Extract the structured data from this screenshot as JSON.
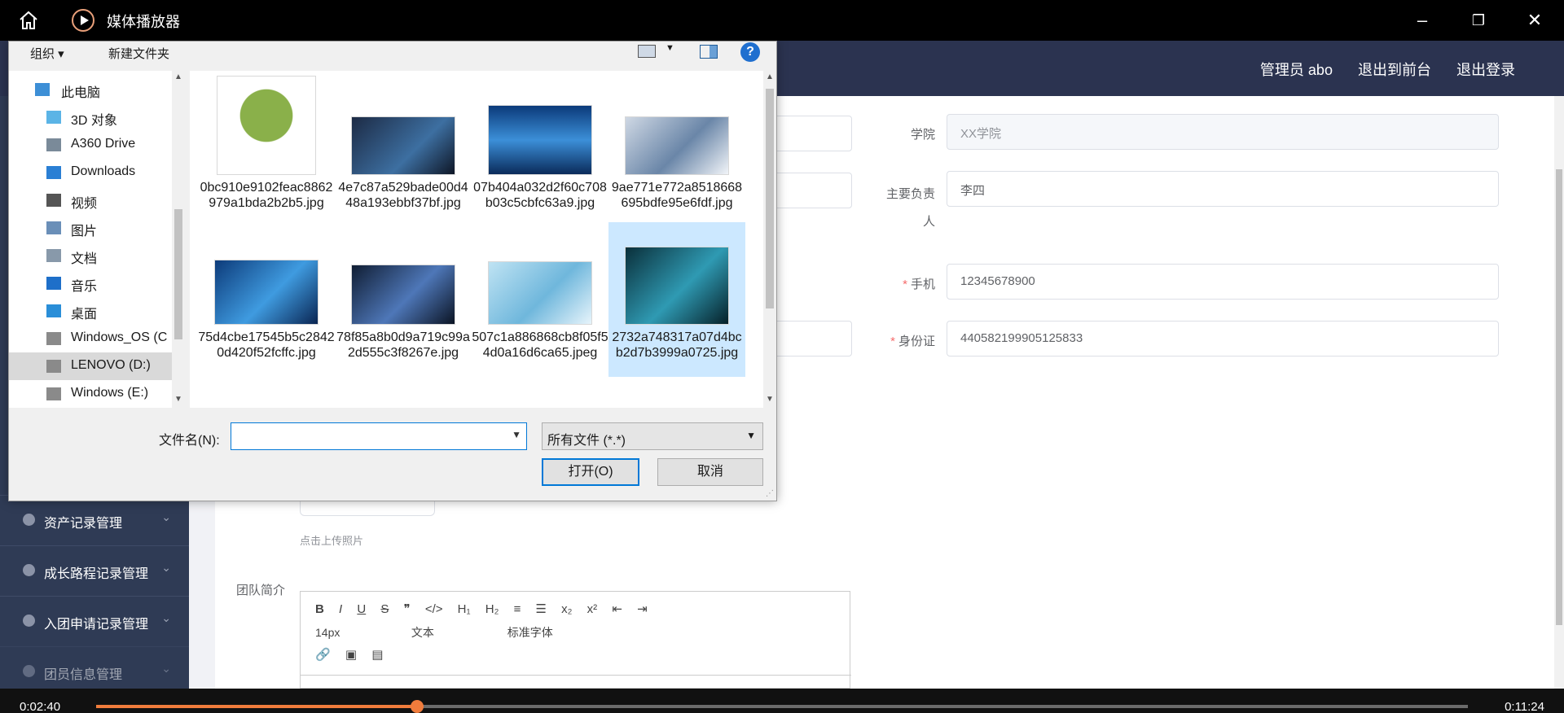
{
  "player": {
    "title": "媒体播放器",
    "current_time": "0:02:40",
    "total_time": "0:11:24",
    "progress": 0.234
  },
  "app": {
    "header_links": [
      "管理员 abo",
      "退出到前台",
      "退出登录"
    ],
    "sidebar": [
      {
        "label": "资产记录管理"
      },
      {
        "label": "成长路程记录管理"
      },
      {
        "label": "入团申请记录管理"
      },
      {
        "label": "团员信息管理"
      }
    ],
    "form": {
      "college_label": "学院",
      "college_value": "XX学院",
      "leader_label": "主要负责人",
      "leader_value": "李四",
      "phone_label": "手机",
      "phone_value": "12345678900",
      "id_label": "身份证",
      "id_value": "440582199905125833",
      "upload_hint": "点击上传照片",
      "team_intro_label": "团队简介"
    },
    "editor": {
      "row1": [
        "B",
        "I",
        "U",
        "S",
        "❞",
        "</>",
        "H₁",
        "H₂",
        "≡",
        "☰",
        "x₂",
        "x²",
        "⇤",
        "⇥"
      ],
      "font_size": "14px",
      "text_style": "文本",
      "font_family": "标准字体"
    }
  },
  "dialog": {
    "organize": "组织 ▾",
    "new_folder": "新建文件夹",
    "nav": [
      {
        "label": "此电脑",
        "icon": "computer-icon"
      },
      {
        "label": "3D 对象",
        "icon": "3d-objects-icon"
      },
      {
        "label": "A360 Drive",
        "icon": "cloud-drive-icon"
      },
      {
        "label": "Downloads",
        "icon": "download-icon"
      },
      {
        "label": "视频",
        "icon": "video-icon"
      },
      {
        "label": "图片",
        "icon": "pictures-icon"
      },
      {
        "label": "文档",
        "icon": "documents-icon"
      },
      {
        "label": "音乐",
        "icon": "music-icon"
      },
      {
        "label": "桌面",
        "icon": "desktop-icon"
      },
      {
        "label": "Windows_OS (C",
        "icon": "drive-icon"
      },
      {
        "label": "LENOVO (D:)",
        "icon": "drive-icon"
      },
      {
        "label": "Windows (E:)",
        "icon": "drive-icon"
      }
    ],
    "files": [
      {
        "name": "0bc910e9102feac8862979a1bda2b2b5.jpg"
      },
      {
        "name": "4e7c87a529bade00d448a193ebbf37bf.jpg"
      },
      {
        "name": "07b404a032d2f60c708b03c5cbfc63a9.jpg"
      },
      {
        "name": "9ae771e772a8518668695bdfe95e6fdf.jpg"
      },
      {
        "name": "75d4cbe17545b5c28420d420f52fcffc.jpg"
      },
      {
        "name": "78f85a8b0d9a719c99a2d555c3f8267e.jpg"
      },
      {
        "name": "507c1a886868cb8f05f54d0a16d6ca65.jpeg"
      },
      {
        "name": "2732a748317a07d4bcb2d7b3999a0725.jpg"
      }
    ],
    "filename_label": "文件名(N):",
    "filename_value": "",
    "filter": "所有文件 (*.*)",
    "open_button": "打开(O)",
    "cancel_button": "取消",
    "help": "?"
  }
}
